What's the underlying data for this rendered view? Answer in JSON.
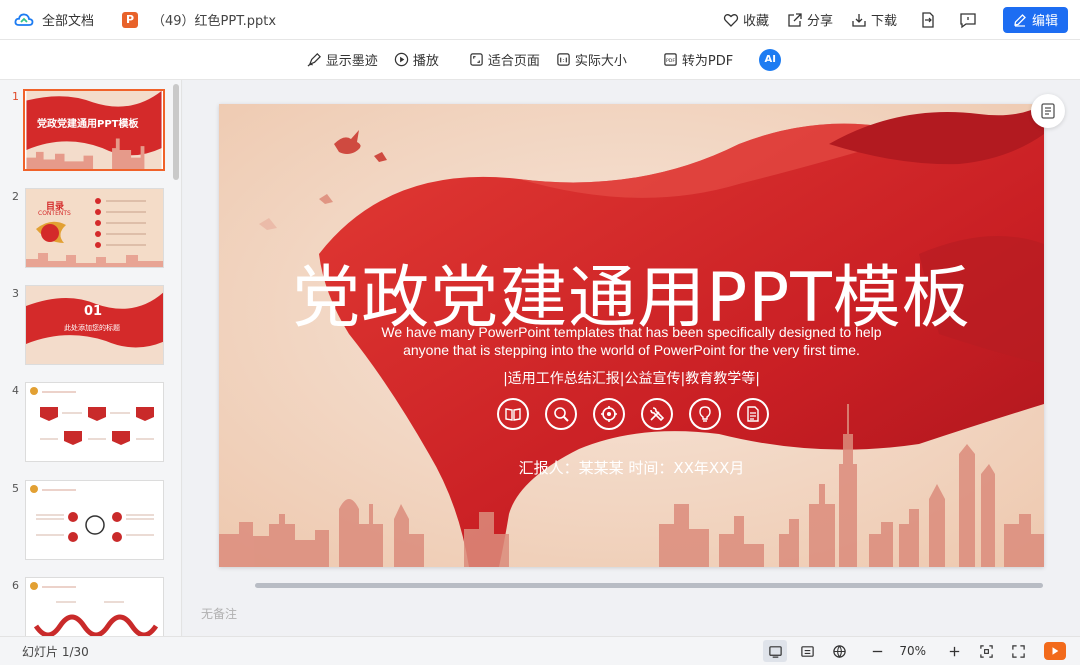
{
  "header": {
    "all_docs": "全部文档",
    "file_name": "（49）红色PPT.pptx",
    "file_icon": "P",
    "collect": "收藏",
    "share": "分享",
    "download": "下载",
    "edit": "编辑",
    "accent": "#1d6df2"
  },
  "toolbar": {
    "show_ink": "显示墨迹",
    "play": "播放",
    "fit_page": "适合页面",
    "actual_size": "实际大小",
    "to_pdf": "转为PDF",
    "ai": "AI"
  },
  "sidebar": {
    "thumbnails": [
      {
        "num": "1",
        "title": "党政党建通用PPT模板"
      },
      {
        "num": "2",
        "title": "目录",
        "subtitle": "CONTENTS"
      },
      {
        "num": "3",
        "title": "01",
        "subtitle": "此处添加您的标题"
      },
      {
        "num": "4"
      },
      {
        "num": "5"
      },
      {
        "num": "6"
      }
    ]
  },
  "slide": {
    "title": "党政党建通用PPT模板",
    "sub_line1": "We have many PowerPoint templates that has been specifically designed to help",
    "sub_line2": "anyone that is stepping into the world of PowerPoint for the very first time.",
    "tags": "|适用工作总结汇报|公益宣传|教育教学等|",
    "reporter": "汇报人：某某某   时间：XX年XX月",
    "icons": [
      "book-icon",
      "magnifier-icon",
      "target-icon",
      "tools-icon",
      "lightbulb-icon",
      "document-icon"
    ],
    "primary_red": "#d42a2a"
  },
  "notes": {
    "placeholder": "无备注"
  },
  "status": {
    "page": "幻灯片 1/30",
    "zoom": "70%"
  }
}
